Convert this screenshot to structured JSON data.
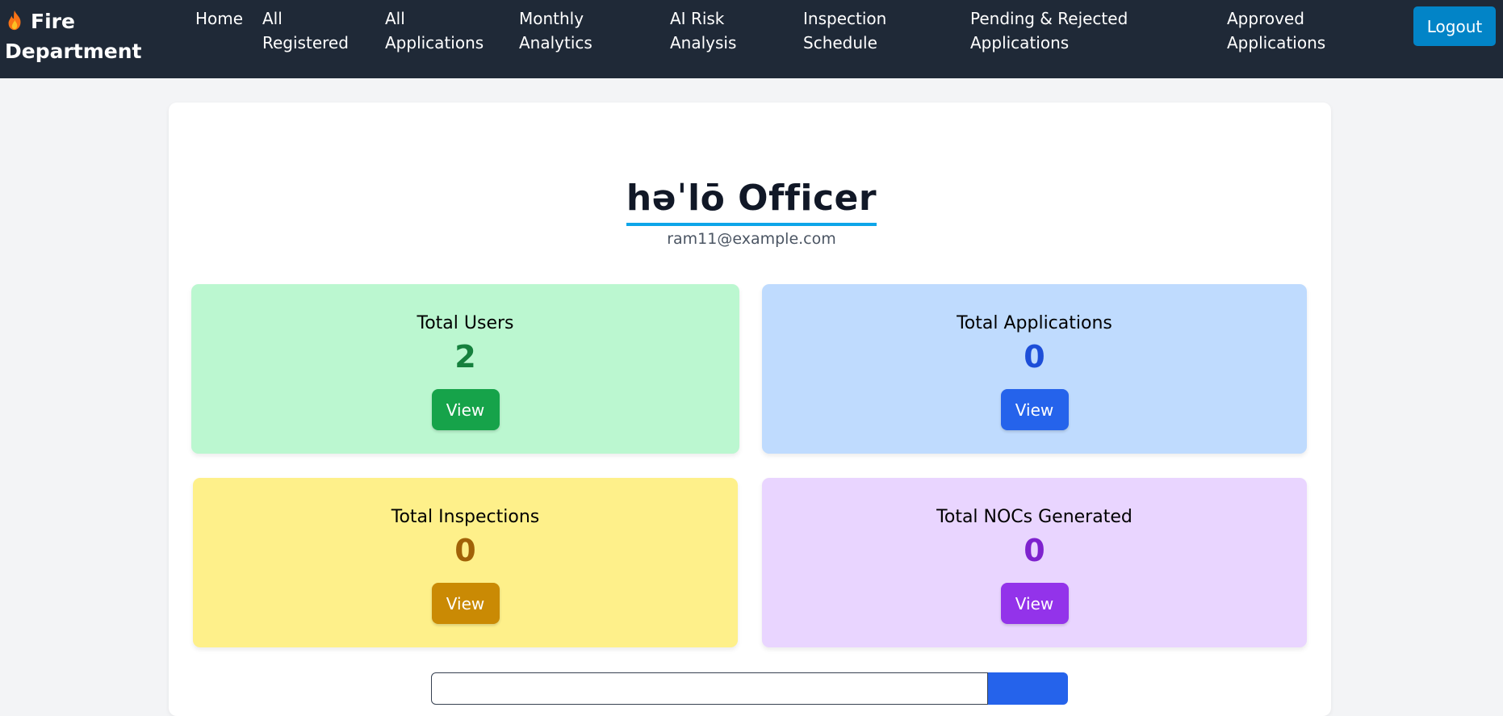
{
  "brand": {
    "line1": "Fire",
    "line2": "Department",
    "icon": "flame-icon"
  },
  "nav": {
    "home": "Home",
    "all_registered_1": "All",
    "all_registered_2": "Registered",
    "all_applications_1": "All",
    "all_applications_2": "Applications",
    "monthly_1": "Monthly",
    "monthly_2": "Analytics",
    "ai_1": "AI Risk",
    "ai_2": "Analysis",
    "inspection_1": "Inspection",
    "inspection_2": "Schedule",
    "pending_1": "Pending & Rejected",
    "pending_2": "Applications",
    "approved_1": "Approved",
    "approved_2": "Applications",
    "logout": "Logout"
  },
  "greeting": "həˈlō Officer",
  "email": "ram11@example.com",
  "stats": {
    "users": {
      "label": "Total Users",
      "value": "2",
      "button": "View"
    },
    "applications": {
      "label": "Total Applications",
      "value": "0",
      "button": "View"
    },
    "inspections": {
      "label": "Total Inspections",
      "value": "0",
      "button": "View"
    },
    "nocs": {
      "label": "Total NOCs Generated",
      "value": "0",
      "button": "View"
    }
  },
  "colors": {
    "navbar": "#1f2937",
    "accent": "#0284c7",
    "users_card": "#bbf7d0",
    "applications_card": "#bfdbfe",
    "inspections_card": "#fef08a",
    "nocs_card": "#e9d5ff"
  }
}
